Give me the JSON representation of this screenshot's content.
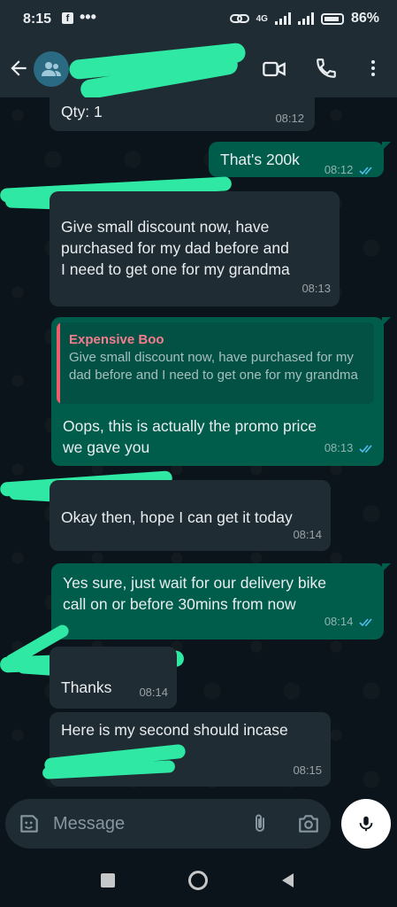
{
  "status_bar": {
    "time": "8:15",
    "dots": "•••",
    "network": "4G",
    "battery": "86%"
  },
  "header": {
    "contact_name": ""
  },
  "messages": [
    {
      "id": "m1",
      "dir": "in",
      "text": "Qty: 1",
      "time": "08:12"
    },
    {
      "id": "m2",
      "dir": "out",
      "text": "That's 200k",
      "time": "08:12"
    },
    {
      "id": "m3",
      "dir": "in",
      "text": "Give small discount now, have\npurchased for my dad before and\nI need to get one for my grandma",
      "time": "08:13"
    },
    {
      "id": "m4",
      "dir": "out",
      "quote_author": "Expensive Boo",
      "quote_text": "Give small discount now, have purchased for my dad before and I need to get one for my grandma",
      "text": "Oops, this is actually the promo price\nwe gave you",
      "time": "08:13"
    },
    {
      "id": "m5",
      "dir": "in",
      "text": "Okay then, hope I can get it today",
      "time": "08:14"
    },
    {
      "id": "m6",
      "dir": "out",
      "text": "Yes sure, just wait for our delivery bike\ncall on or before 30mins from now",
      "time": "08:14"
    },
    {
      "id": "m7",
      "dir": "in",
      "text": "Thanks",
      "time": "08:14"
    },
    {
      "id": "m8",
      "dir": "in",
      "text": "Here is my second should incase",
      "time": "08:15"
    }
  ],
  "input": {
    "placeholder": "Message"
  },
  "colors": {
    "incoming": "#202c33",
    "outgoing": "#005c4b",
    "read_ticks": "#53bdeb",
    "redaction": "#2ee8a3"
  },
  "icons": [
    "back-arrow-icon",
    "group-avatar-icon",
    "video-call-icon",
    "voice-call-icon",
    "more-options-icon",
    "sticker-icon",
    "attach-icon",
    "camera-icon",
    "mic-icon",
    "nav-square-icon",
    "nav-circle-icon",
    "nav-triangle-icon"
  ]
}
